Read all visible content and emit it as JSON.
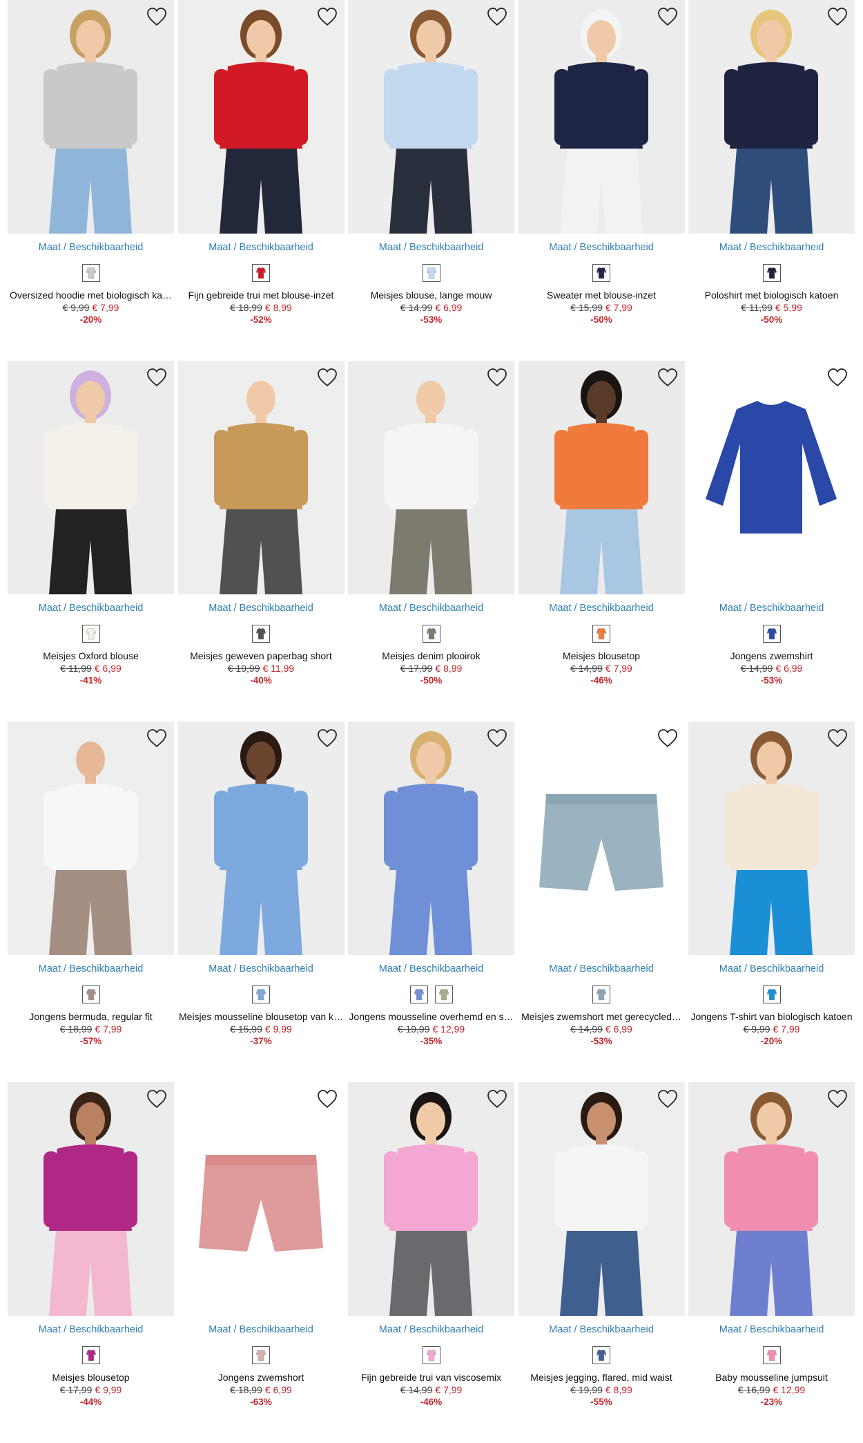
{
  "availability_label": "Maat / Beschikbaarheid",
  "products": [
    {
      "name": "Oversized hoodie met biologisch ka…",
      "old": "€ 9,99",
      "new": "€ 7,99",
      "discount": "-20%",
      "bg": "#ececec",
      "top": "#c9c9c9",
      "bottom": "#8fb6d8",
      "skin": "#f0c9a8",
      "hair": "#c9a064",
      "swatches": [
        "#c9c9c9"
      ]
    },
    {
      "name": "Fijn gebreide trui met blouse-inzet",
      "old": "€ 18,99",
      "new": "€ 8,99",
      "discount": "-52%",
      "bg": "#eeeeee",
      "top": "#d11a25",
      "bottom": "#22283a",
      "skin": "#f0c9a8",
      "hair": "#7a4b2a",
      "swatches": [
        "#d11a25"
      ]
    },
    {
      "name": "Meisjes blouse, lange mouw",
      "old": "€ 14,99",
      "new": "€ 6,99",
      "discount": "-53%",
      "bg": "#ededed",
      "top": "#c3d9ef",
      "bottom": "#2a2f3d",
      "skin": "#f0c9a8",
      "hair": "#8a5a34",
      "swatches": [
        "#c3d9ef"
      ]
    },
    {
      "name": "Sweater met blouse-inzet",
      "old": "€ 15,99",
      "new": "€ 7,99",
      "discount": "-50%",
      "bg": "#ececec",
      "top": "#1d2444",
      "bottom": "#f2f2f2",
      "skin": "#f0c9a8",
      "hair": "#f4f4f4",
      "swatches": [
        "#1d2444"
      ]
    },
    {
      "name": "Poloshirt met biologisch katoen",
      "old": "€ 11,99",
      "new": "€ 5,99",
      "discount": "-50%",
      "bg": "#ededed",
      "top": "#1e2340",
      "bottom": "#2f4d7a",
      "skin": "#f0c9a8",
      "hair": "#e6c57c",
      "swatches": [
        "#1e2340"
      ]
    },
    {
      "name": "Meisjes Oxford blouse",
      "old": "€ 11,99",
      "new": "€ 6,99",
      "discount": "-41%",
      "bg": "#ececec",
      "top": "#f3f1ea",
      "bottom": "#222222",
      "skin": "#f0c9a8",
      "hair": "#cfb1e0",
      "swatches": [
        "#f3f1ea"
      ]
    },
    {
      "name": "Meisjes geweven paperbag short",
      "old": "€ 19,99",
      "new": "€ 11,99",
      "discount": "-40%",
      "bg": "#eeeeee",
      "top": "#c79a5a",
      "bottom": "#4f524f",
      "skin": "#f0c9a8",
      "hair": "#eeeeee",
      "swatches": [
        "#4f524f"
      ]
    },
    {
      "name": "Meisjes denim plooirok",
      "old": "€ 17,99",
      "new": "€ 8,99",
      "discount": "-50%",
      "bg": "#ececec",
      "top": "#f5f5f5",
      "bottom": "#7d7a70",
      "skin": "#f0c9a8",
      "hair": "#ececec",
      "swatches": [
        "#7d7a70"
      ]
    },
    {
      "name": "Meisjes blousetop",
      "old": "€ 14,99",
      "new": "€ 7,99",
      "discount": "-46%",
      "bg": "#ebebeb",
      "top": "#f07a3c",
      "bottom": "#a9c6e2",
      "skin": "#5a3a28",
      "hair": "#1a1412",
      "swatches": [
        "#f07a3c"
      ]
    },
    {
      "name": "Jongens zwemshirt",
      "old": "€ 14,99",
      "new": "€ 6,99",
      "discount": "-53%",
      "bg": "#ffffff",
      "top": "#2948a8",
      "bottom": "#ffffff",
      "skin": "#ffffff",
      "hair": "#ffffff",
      "swatches": [
        "#2948a8"
      ]
    },
    {
      "name": "Jongens bermuda, regular fit",
      "old": "€ 18,99",
      "new": "€ 7,99",
      "discount": "-57%",
      "bg": "#eeeeee",
      "top": "#f7f7f7",
      "bottom": "#a58f83",
      "skin": "#e6b898",
      "hair": "#eeeeee",
      "swatches": [
        "#a58f83"
      ]
    },
    {
      "name": "Meisjes mousseline blousetop van k…",
      "old": "€ 15,99",
      "new": "€ 9,99",
      "discount": "-37%",
      "bg": "#ededed",
      "top": "#7ea9de",
      "bottom": "#7ea9de",
      "skin": "#6b4530",
      "hair": "#2a1a12",
      "swatches": [
        "#7ea9de"
      ]
    },
    {
      "name": "Jongens mousseline overhemd en s…",
      "old": "€ 19,99",
      "new": "€ 12,99",
      "discount": "-35%",
      "bg": "#ececec",
      "top": "#6f8fd6",
      "bottom": "#6f8fd6",
      "skin": "#f0c9a8",
      "hair": "#d8b070",
      "swatches": [
        "#6f8fd6",
        "#a8b08a"
      ]
    },
    {
      "name": "Meisjes zwemshort met gerecycled…",
      "old": "€ 14,99",
      "new": "€ 6,99",
      "discount": "-53%",
      "bg": "#ffffff",
      "top": "#ffffff",
      "bottom": "#8aa6b5",
      "skin": "#ffffff",
      "hair": "#ffffff",
      "swatches": [
        "#8aa6b5"
      ]
    },
    {
      "name": "Jongens T-shirt van biologisch katoen",
      "old": "€ 9,99",
      "new": "€ 7,99",
      "discount": "-20%",
      "bg": "#ececec",
      "top": "#f3e8d6",
      "bottom": "#1a8fd6",
      "skin": "#f0c9a8",
      "hair": "#8a5a34",
      "swatches": [
        "#1a8fd6"
      ]
    },
    {
      "name": "Meisjes blousetop",
      "old": "€ 17,99",
      "new": "€ 9,99",
      "discount": "-44%",
      "bg": "#ececec",
      "top": "#b02886",
      "bottom": "#f3b7cf",
      "skin": "#b98062",
      "hair": "#3a2418",
      "swatches": [
        "#b02886"
      ]
    },
    {
      "name": "Jongens zwemshort",
      "old": "€ 18,99",
      "new": "€ 6,99",
      "discount": "-63%",
      "bg": "#ffffff",
      "top": "#ffffff",
      "bottom": "#d98a8a",
      "skin": "#ffffff",
      "hair": "#ffffff",
      "swatches": [
        "#d9b0b0"
      ]
    },
    {
      "name": "Fijn gebreide trui van viscosemix",
      "old": "€ 14,99",
      "new": "€ 7,99",
      "discount": "-46%",
      "bg": "#ececec",
      "top": "#f3a7d2",
      "bottom": "#6a6a6e",
      "skin": "#f0c9a8",
      "hair": "#1a1412",
      "swatches": [
        "#f3a7d2"
      ]
    },
    {
      "name": "Meisjes jegging, flared, mid waist",
      "old": "€ 19,99",
      "new": "€ 8,99",
      "discount": "-55%",
      "bg": "#eeeeee",
      "top": "#f5f5f5",
      "bottom": "#3f5f8f",
      "skin": "#c99070",
      "hair": "#2a1a12",
      "swatches": [
        "#3f5f8f"
      ]
    },
    {
      "name": "Baby mousseline jumpsuit",
      "old": "€ 16,99",
      "new": "€ 12,99",
      "discount": "-23%",
      "bg": "#ececec",
      "top": "#f08db0",
      "bottom": "#6f7fd0",
      "skin": "#f0c9a8",
      "hair": "#8a5a34",
      "swatches": [
        "#f08db0"
      ]
    }
  ]
}
